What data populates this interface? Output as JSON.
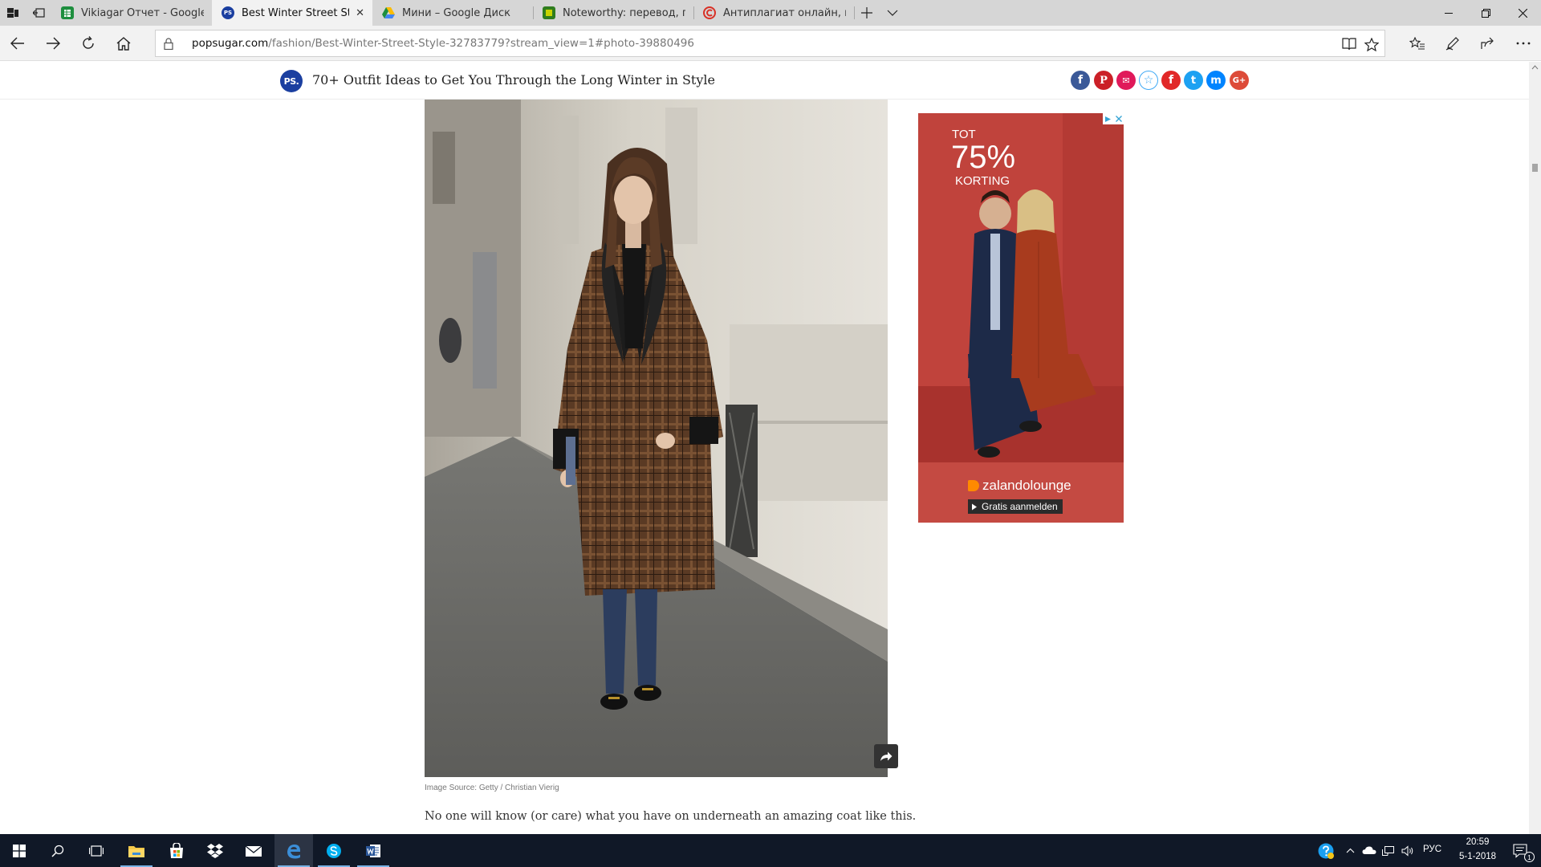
{
  "browser": {
    "tabs": [
      {
        "title": "Vikiagar Отчет - Google Tat",
        "favicon_color": "#1e8e3e",
        "active": false
      },
      {
        "title": "Best Winter Street Style",
        "favicon_color": "#1b3fa0",
        "active": true
      },
      {
        "title": "Мини – Google Диск",
        "favicon_color": "#fbbc04",
        "active": false
      },
      {
        "title": "Noteworthy: перевод, прои",
        "favicon_color": "#2f7d1e",
        "active": false
      },
      {
        "title": "Антиплагиат онлайн, пров",
        "favicon_color": "#d93025",
        "active": false
      }
    ],
    "url_host": "popsugar.com",
    "url_path": "/fashion/Best-Winter-Street-Style-32783779?stream_view=1#photo-39880496"
  },
  "page": {
    "logo_text": "PS.",
    "title": "70+ Outfit Ideas to Get You Through the Long Winter in Style",
    "share_buttons": [
      {
        "name": "facebook",
        "glyph": "f",
        "color": "#3b5998"
      },
      {
        "name": "pinterest",
        "glyph": "P",
        "color": "#cb2027"
      },
      {
        "name": "email",
        "glyph": "✉",
        "color": "#e0195a"
      },
      {
        "name": "favorite",
        "glyph": "☆",
        "color": "#ffffff"
      },
      {
        "name": "flipboard",
        "glyph": "f",
        "color": "#e12828"
      },
      {
        "name": "twitter",
        "glyph": "t",
        "color": "#1da1f2"
      },
      {
        "name": "messenger",
        "glyph": "m",
        "color": "#0084ff"
      },
      {
        "name": "google-plus",
        "glyph": "G+",
        "color": "#dd4b39"
      }
    ],
    "image_credit": "Image Source: Getty / Christian Vierig",
    "caption": "No one will know (or care) what you have on underneath an amazing coat like this."
  },
  "ad": {
    "line1": "TOT",
    "discount": "75%",
    "line2": "KORTING",
    "brand": "zalandolounge",
    "cta": "Gratis aanmelden",
    "bg_color": "#c0433c"
  },
  "taskbar": {
    "language": "РУС",
    "time": "20:59",
    "date": "5-1-2018",
    "notification_count": "1"
  }
}
